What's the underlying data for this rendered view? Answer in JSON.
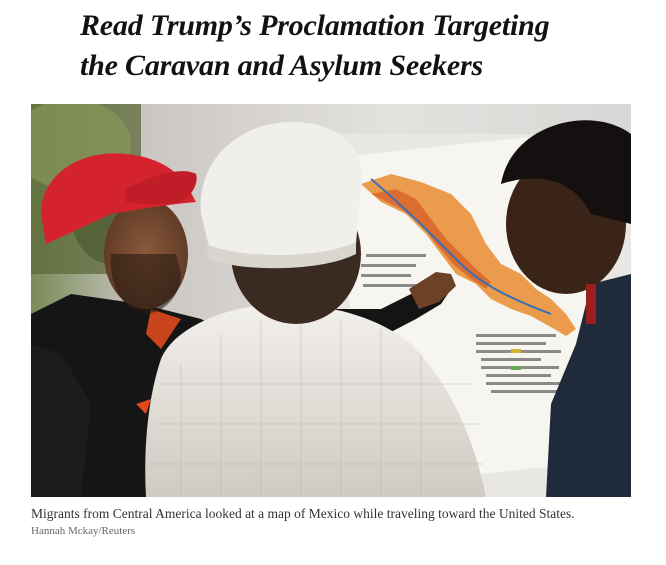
{
  "article": {
    "headline_line1": "Read Trump’s Proclamation Targeting",
    "headline_line2": "the Caravan and Asylum Seekers"
  },
  "photo": {
    "caption": "Migrants from Central America looked at a map of Mexico while traveling toward the United States.",
    "credit": "Hannah Mckay/Reuters"
  },
  "colors": {
    "headline": "#121212",
    "caption": "#333333",
    "credit": "#666666",
    "cap_red": "#d4232f",
    "map_orange": "#e8923a"
  }
}
